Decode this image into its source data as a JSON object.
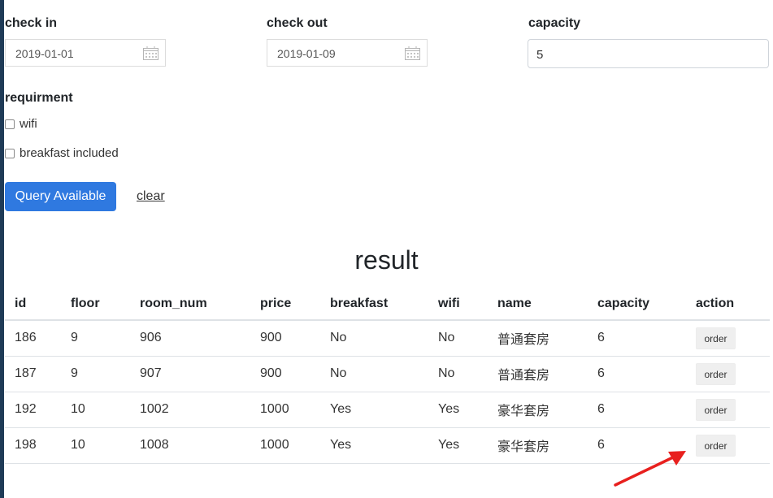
{
  "search": {
    "check_in": {
      "label": "check in",
      "value": "2019-01-01"
    },
    "check_out": {
      "label": "check out",
      "value": "2019-01-09"
    },
    "capacity": {
      "label": "capacity",
      "value": "5"
    },
    "requirement": {
      "label": "requirment",
      "options": [
        {
          "label": "wifi",
          "checked": false
        },
        {
          "label": "breakfast included",
          "checked": false
        }
      ]
    },
    "query_label": "Query Available",
    "clear_label": "clear"
  },
  "result": {
    "title": "result",
    "columns": [
      "id",
      "floor",
      "room_num",
      "price",
      "breakfast",
      "wifi",
      "name",
      "capacity",
      "action"
    ],
    "rows": [
      {
        "id": "186",
        "floor": "9",
        "room_num": "906",
        "price": "900",
        "breakfast": "No",
        "wifi": "No",
        "name": "普通套房",
        "capacity": "6",
        "action": "order"
      },
      {
        "id": "187",
        "floor": "9",
        "room_num": "907",
        "price": "900",
        "breakfast": "No",
        "wifi": "No",
        "name": "普通套房",
        "capacity": "6",
        "action": "order"
      },
      {
        "id": "192",
        "floor": "10",
        "room_num": "1002",
        "price": "1000",
        "breakfast": "Yes",
        "wifi": "Yes",
        "name": "豪华套房",
        "capacity": "6",
        "action": "order"
      },
      {
        "id": "198",
        "floor": "10",
        "room_num": "1008",
        "price": "1000",
        "breakfast": "Yes",
        "wifi": "Yes",
        "name": "豪华套房",
        "capacity": "6",
        "action": "order"
      }
    ]
  },
  "colors": {
    "primary": "#2f79e0",
    "annotation_arrow": "#e8201e",
    "left_edge": "#1f3b57"
  },
  "icons": {
    "date_picker": "calendar-icon",
    "annotation": "red-arrow-icon"
  }
}
